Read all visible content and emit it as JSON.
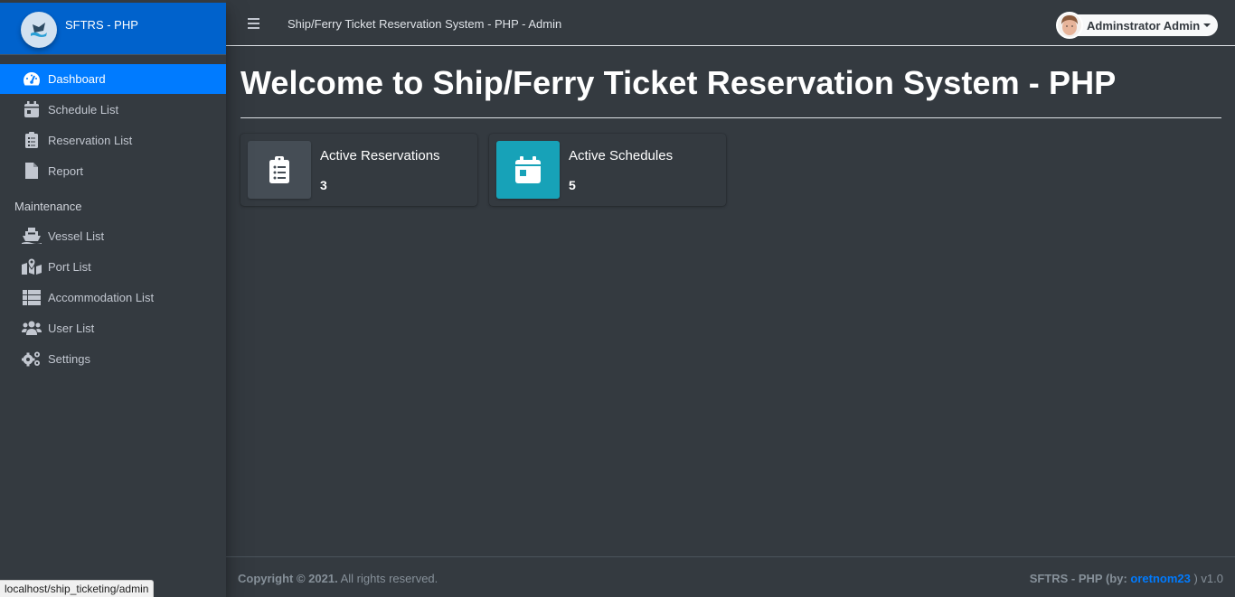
{
  "brand": {
    "name": "SFTRS - PHP",
    "logo_icon": "ship-logo-icon"
  },
  "sidebar": {
    "items": [
      {
        "label": "Dashboard",
        "icon": "tachometer-icon",
        "active": true
      },
      {
        "label": "Schedule List",
        "icon": "calendar-icon"
      },
      {
        "label": "Reservation List",
        "icon": "clipboard-list-icon"
      },
      {
        "label": "Report",
        "icon": "file-icon"
      }
    ],
    "maintenance_header": "Maintenance",
    "maintenance_items": [
      {
        "label": "Vessel List",
        "icon": "ship-icon"
      },
      {
        "label": "Port List",
        "icon": "map-marked-icon"
      },
      {
        "label": "Accommodation List",
        "icon": "table-icon"
      },
      {
        "label": "User List",
        "icon": "users-icon"
      },
      {
        "label": "Settings",
        "icon": "cogs-icon"
      }
    ]
  },
  "topbar": {
    "title": "Ship/Ferry Ticket Reservation System - PHP - Admin",
    "user_name": "Adminstrator Admin"
  },
  "main": {
    "page_title": "Welcome to Ship/Ferry Ticket Reservation System - PHP",
    "info_boxes": [
      {
        "label": "Active Reservations",
        "value": "3",
        "icon": "clipboard-list-icon",
        "color": "#454d55"
      },
      {
        "label": "Active Schedules",
        "value": "5",
        "icon": "calendar-icon",
        "color": "#17a2b8"
      }
    ]
  },
  "footer": {
    "copyright_bold": "Copyright © 2021.",
    "copyright_rest": " All rights reserved.",
    "version_prefix": "SFTRS - PHP (by: ",
    "author_link": "oretnom23",
    "version_suffix": " ) v1.0"
  },
  "status_bar": {
    "url": "localhost/ship_ticketing/admin"
  },
  "colors": {
    "brand": "#0062cc",
    "active": "#007bff",
    "info": "#17a2b8",
    "dark": "#343a40"
  }
}
